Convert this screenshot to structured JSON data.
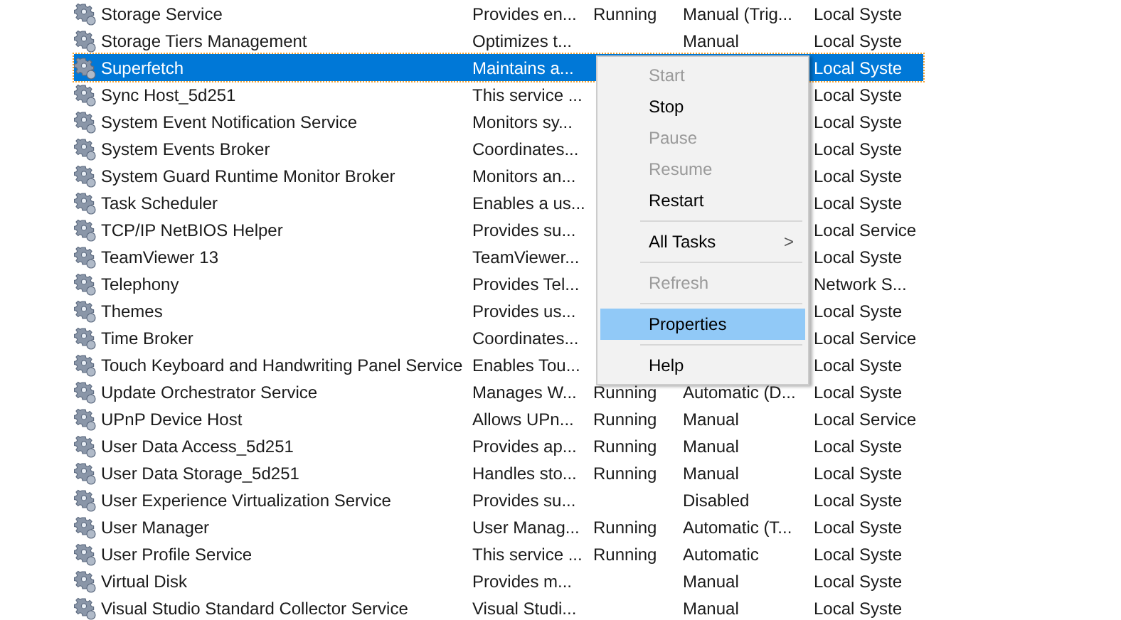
{
  "services": [
    {
      "name": "Storage Service",
      "description": "Provides en...",
      "status": "Running",
      "startup": "Manual (Trig...",
      "logon": "Local Syste",
      "selected": false
    },
    {
      "name": "Storage Tiers Management",
      "description": "Optimizes t...",
      "startup": "Manual",
      "logon": "Local Syste",
      "selected": false
    },
    {
      "name": "Superfetch",
      "description": "Maintains a...",
      "logon": "Local Syste",
      "selected": true
    },
    {
      "name": "Sync Host_5d251",
      "description": "This service ...",
      "logon": "Local Syste",
      "selected": false
    },
    {
      "name": "System Event Notification Service",
      "description": "Monitors sy...",
      "logon": "Local Syste",
      "selected": false
    },
    {
      "name": "System Events Broker",
      "description": "Coordinates...",
      "logon": "Local Syste",
      "selected": false
    },
    {
      "name": "System Guard Runtime Monitor Broker",
      "description": "Monitors an...",
      "logon": "Local Syste",
      "selected": false
    },
    {
      "name": "Task Scheduler",
      "description": "Enables a us...",
      "logon": "Local Syste",
      "selected": false
    },
    {
      "name": "TCP/IP NetBIOS Helper",
      "description": "Provides su...",
      "logon": "Local Service",
      "selected": false
    },
    {
      "name": "TeamViewer 13",
      "description": "TeamViewer...",
      "logon": "Local Syste",
      "selected": false
    },
    {
      "name": "Telephony",
      "description": "Provides Tel...",
      "logon": "Network S...",
      "selected": false
    },
    {
      "name": "Themes",
      "description": "Provides us...",
      "logon": "Local Syste",
      "selected": false
    },
    {
      "name": "Time Broker",
      "description": "Coordinates...",
      "logon": "Local Service",
      "selected": false
    },
    {
      "name": "Touch Keyboard and Handwriting Panel Service",
      "description": "Enables Tou...",
      "logon": "Local Syste",
      "selected": false
    },
    {
      "name": "Update Orchestrator Service",
      "description": "Manages W...",
      "status": "Running",
      "startup": "Automatic (D...",
      "logon": "Local Syste",
      "selected": false
    },
    {
      "name": "UPnP Device Host",
      "description": "Allows UPn...",
      "status": "Running",
      "startup": "Manual",
      "logon": "Local Service",
      "selected": false
    },
    {
      "name": "User Data Access_5d251",
      "description": "Provides ap...",
      "status": "Running",
      "startup": "Manual",
      "logon": "Local Syste",
      "selected": false
    },
    {
      "name": "User Data Storage_5d251",
      "description": "Handles sto...",
      "status": "Running",
      "startup": "Manual",
      "logon": "Local Syste",
      "selected": false
    },
    {
      "name": "User Experience Virtualization Service",
      "description": "Provides su...",
      "startup": "Disabled",
      "logon": "Local Syste",
      "selected": false
    },
    {
      "name": "User Manager",
      "description": "User Manag...",
      "status": "Running",
      "startup": "Automatic (T...",
      "logon": "Local Syste",
      "selected": false
    },
    {
      "name": "User Profile Service",
      "description": "This service ...",
      "status": "Running",
      "startup": "Automatic",
      "logon": "Local Syste",
      "selected": false
    },
    {
      "name": "Virtual Disk",
      "description": "Provides m...",
      "startup": "Manual",
      "logon": "Local Syste",
      "selected": false
    },
    {
      "name": "Visual Studio Standard Collector Service",
      "description": "Visual Studi...",
      "startup": "Manual",
      "logon": "Local Syste",
      "selected": false
    }
  ],
  "context_menu": [
    {
      "kind": "item",
      "label": "Start",
      "disabled": true,
      "selected": false
    },
    {
      "kind": "item",
      "label": "Stop",
      "disabled": false,
      "selected": false
    },
    {
      "kind": "item",
      "label": "Pause",
      "disabled": true,
      "selected": false
    },
    {
      "kind": "item",
      "label": "Resume",
      "disabled": true,
      "selected": false
    },
    {
      "kind": "item",
      "label": "Restart",
      "disabled": false,
      "selected": false
    },
    {
      "kind": "separator"
    },
    {
      "kind": "submenu",
      "label": "All Tasks",
      "arrow": ">",
      "disabled": false,
      "selected": false
    },
    {
      "kind": "separator"
    },
    {
      "kind": "item",
      "label": "Refresh",
      "disabled": true,
      "selected": false
    },
    {
      "kind": "separator"
    },
    {
      "kind": "item",
      "label": "Properties",
      "disabled": false,
      "selected": true
    },
    {
      "kind": "separator"
    },
    {
      "kind": "item",
      "label": "Help",
      "disabled": false,
      "selected": false
    }
  ]
}
